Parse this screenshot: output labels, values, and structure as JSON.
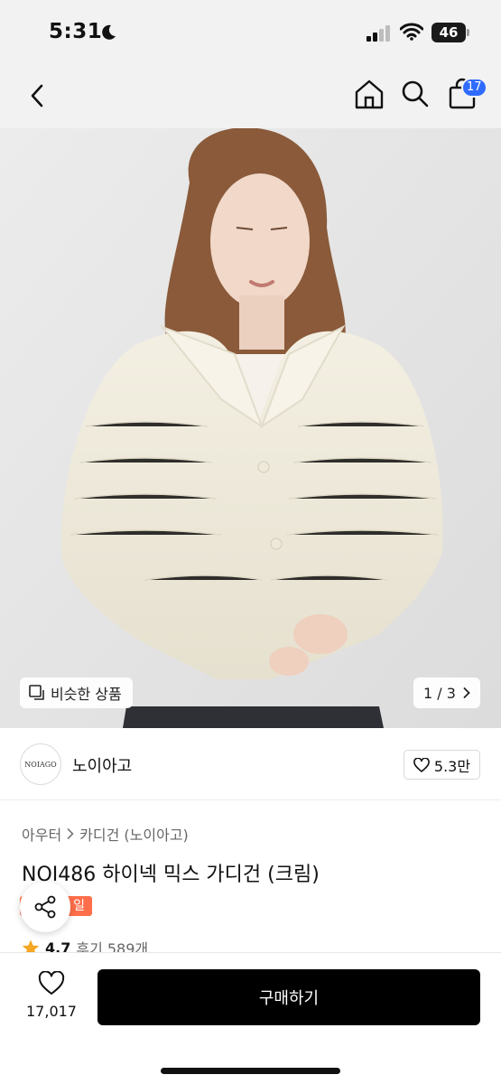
{
  "status_bar": {
    "time": "5:31",
    "battery": "46"
  },
  "nav": {
    "cart_badge": "17"
  },
  "hero": {
    "similar_label": "비슷한 상품",
    "pager": "1 / 3"
  },
  "brand": {
    "logo_text": "NOIAGO",
    "name": "노이아고",
    "likes": "5.3만"
  },
  "product": {
    "breadcrumb": [
      "아우터",
      "카디건 (노이아고)"
    ],
    "title": "NOI486 하이넥 믹스 가디건 (크림)",
    "badge": "일",
    "rating": "4.7",
    "review_label": "후기 589개"
  },
  "bottom": {
    "wish_count": "17,017",
    "buy_label": "구매하기"
  },
  "colors": {
    "accent_blue": "#2f6bff",
    "sale_badge": "#ff6e4a",
    "buy_button": "#000000",
    "star": "#f5a623"
  }
}
